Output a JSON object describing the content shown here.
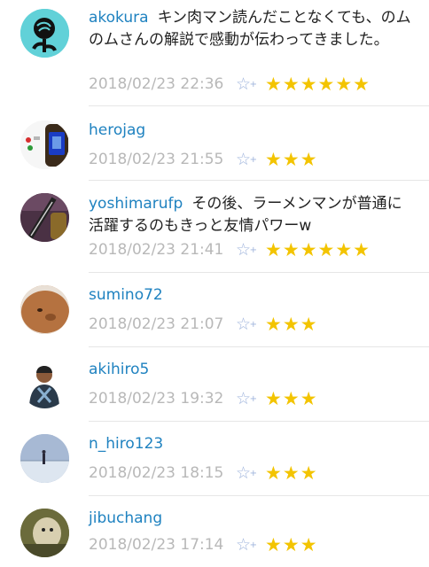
{
  "comments": [
    {
      "user": "akokura",
      "text": "キン肉マン読んだことなくても、のムのムさんの解説で感動が伝わってきました。",
      "date": "2018/02/23 22:36",
      "stars": "★★★★★★"
    },
    {
      "user": "herojag",
      "text": "",
      "date": "2018/02/23 21:55",
      "stars": "★★★"
    },
    {
      "user": "yoshimarufp",
      "text": "その後、ラーメンマンが普通に活躍するのもきっと友情パワーw",
      "date": "2018/02/23 21:41",
      "stars": "★★★★★★"
    },
    {
      "user": "sumino72",
      "text": "",
      "date": "2018/02/23 21:07",
      "stars": "★★★"
    },
    {
      "user": "akihiro5",
      "text": "",
      "date": "2018/02/23 19:32",
      "stars": "★★★"
    },
    {
      "user": "n_hiro123",
      "text": "",
      "date": "2018/02/23 18:15",
      "stars": "★★★"
    },
    {
      "user": "jibuchang",
      "text": "",
      "date": "2018/02/23 17:14",
      "stars": "★★★"
    }
  ],
  "icons": {
    "add_star": "☆",
    "add_plus": "+"
  }
}
